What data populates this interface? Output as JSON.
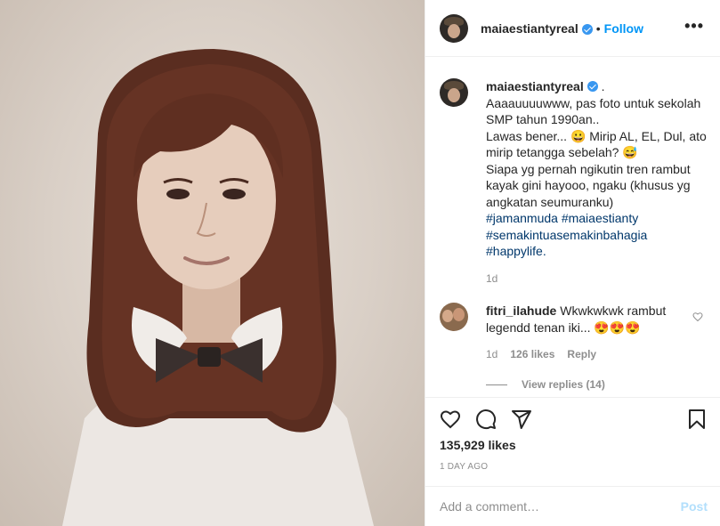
{
  "post": {
    "username": "maiaestiantyreal",
    "follow_label": "Follow",
    "separator": "•",
    "more_label": "•••"
  },
  "caption": {
    "username": "maiaestiantyreal",
    "suffix": ".",
    "lines": [
      "Aaaauuuuwww, pas foto untuk sekolah SMP tahun 1990an..",
      "Lawas bener... 😀 Mirip AL, EL, Dul, ato mirip tetangga sebelah? 😅",
      "Siapa yg pernah ngikutin tren rambut kayak gini hayooo, ngaku (khusus yg angkatan seumuranku)"
    ],
    "hashtags": [
      "#jamanmuda #maiaestianty",
      "#semakintuasemakinbahagia",
      "#happylife."
    ],
    "time": "1d"
  },
  "comment": {
    "username": "fitri_ilahude",
    "text": "Wkwkwkwk rambut legendd tenan iki... 😍😍😍",
    "time": "1d",
    "likes": "126 likes",
    "reply_label": "Reply",
    "view_replies": "View replies (14)"
  },
  "actions": {
    "likes": "135,929 likes",
    "ago": "1 DAY AGO"
  },
  "add_comment": {
    "placeholder": "Add a comment…",
    "post_label": "Post"
  },
  "colors": {
    "accent": "#0095f6",
    "link": "#00376b",
    "muted": "#8e8e8e",
    "border": "#efefef"
  }
}
